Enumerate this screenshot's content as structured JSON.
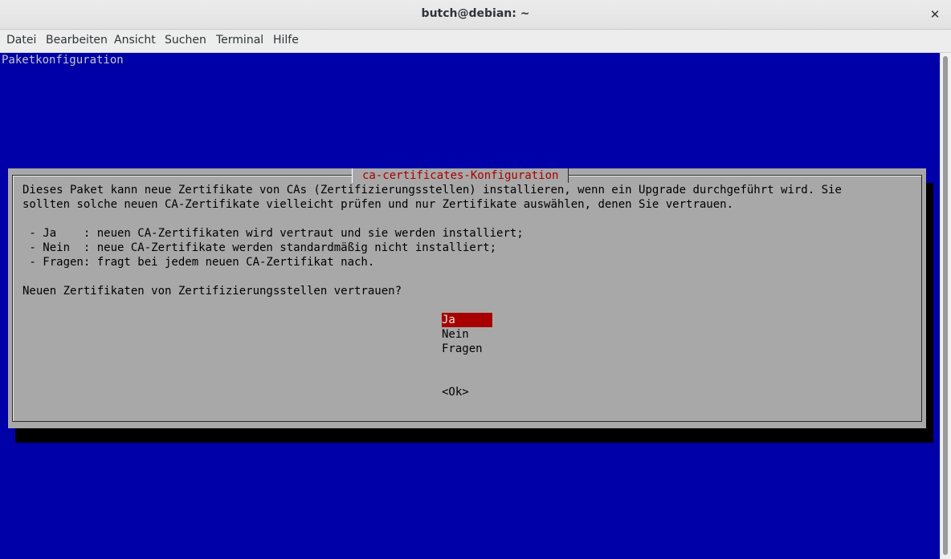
{
  "window": {
    "title": "butch@debian: ~",
    "close_symbol": "✕"
  },
  "menubar": {
    "items": [
      "Datei",
      "Bearbeiten",
      "Ansicht",
      "Suchen",
      "Terminal",
      "Hilfe"
    ]
  },
  "terminal": {
    "backtitle": "Paketkonfiguration",
    "dialog": {
      "title": "ca-certificates-Konfiguration",
      "lines": [
        "Dieses Paket kann neue Zertifikate von CAs (Zertifizierungsstellen) installieren, wenn ein Upgrade durchgeführt wird. Sie",
        "sollten solche neuen CA-Zertifikate vielleicht prüfen und nur Zertifikate auswählen, denen Sie vertrauen.",
        "",
        " - Ja    : neuen CA-Zertifikaten wird vertraut und sie werden installiert;",
        " - Nein  : neue CA-Zertifikate werden standardmäßig nicht installiert;",
        " - Fragen: fragt bei jedem neuen CA-Zertifikat nach.",
        "",
        "Neuen Zertifikaten von Zertifizierungsstellen vertrauen?"
      ],
      "options": [
        "Ja",
        "Nein",
        "Fragen"
      ],
      "selected_option": "Ja",
      "ok_button": "<Ok>"
    }
  },
  "colors": {
    "terminal_bg": "#0000a8",
    "dialog_bg": "#a8a8a8",
    "title_red": "#a80000",
    "selected_bg": "#a80000"
  }
}
